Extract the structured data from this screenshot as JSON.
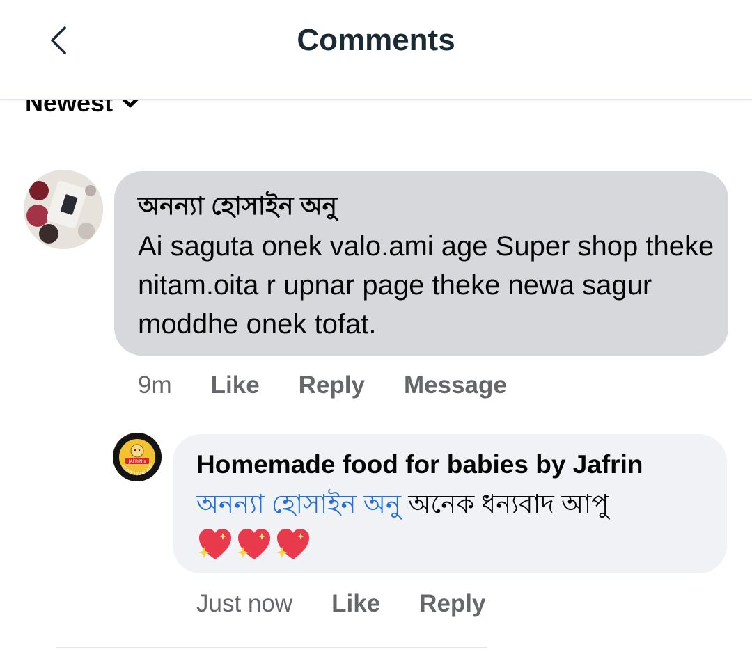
{
  "header": {
    "title": "Comments",
    "back_icon": "chevron-left-icon"
  },
  "sort": {
    "label": "Newest",
    "icon": "chevron-down-icon"
  },
  "comment": {
    "author": "অনন্যা হোসাইন অনু",
    "text": "Ai saguta onek valo.ami age Super shop theke nitam.oita r upnar page theke newa sagur moddhe onek tofat.",
    "time": "9m",
    "like_label": "Like",
    "reply_label": "Reply",
    "message_label": "Message"
  },
  "reply": {
    "author": "Homemade food for babies by Jafrin",
    "mention": "অনন্যা হোসাইন অনু",
    "text": "অনেক ধন্যবাদ আপু",
    "hearts_icon": "sparkling-heart-icon",
    "hearts_count": 3,
    "time": "Just now",
    "like_label": "Like",
    "reply_label": "Reply",
    "logo_text": "JAFRIN's HOMEMADE FOOD"
  },
  "colors": {
    "bubble_main": "#d6d8dc",
    "bubble_reply": "#f0f2f5",
    "mention": "#216fdb",
    "secondary_text": "#65676b"
  }
}
